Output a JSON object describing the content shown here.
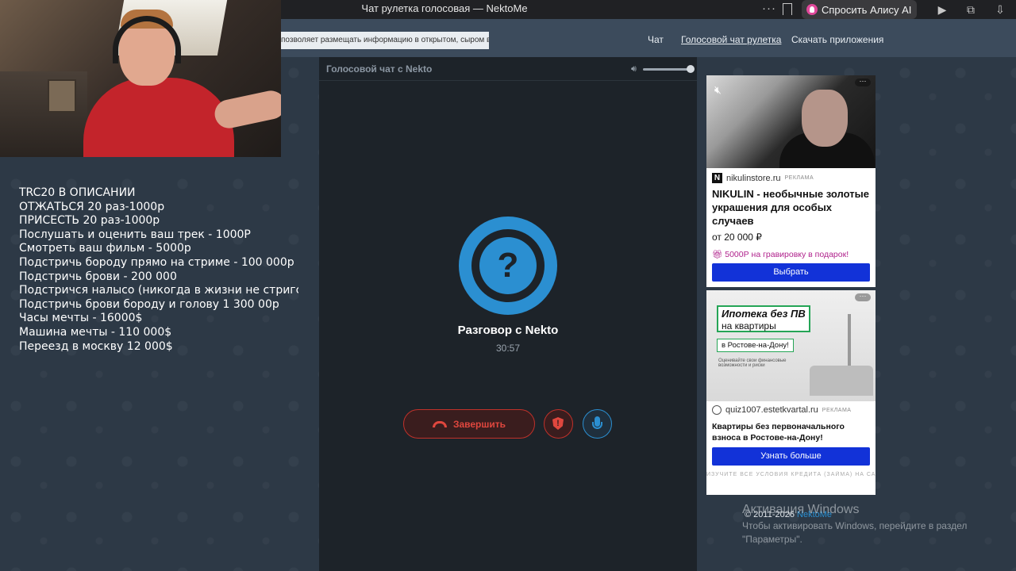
{
  "browser": {
    "title": "Чат рулетка голосовая — NektoMe",
    "alice_label": "Спросить Алису AI"
  },
  "site": {
    "notice": "позволяет размещать информацию в открытом, сыром виде!",
    "nav": [
      "Чат",
      "Голосовой чат рулетка",
      "Скачать приложения"
    ],
    "nav_active": "Голосовой чат рулетка"
  },
  "overlay": {
    "lines": [
      "TRC20 В ОПИСАНИИ",
      "ОТЖАТЬСЯ 20 раз-1000р",
      "ПРИСЕСТЬ 20 раз-1000р",
      "Послушать и оценить ваш трек - 1000Р",
      "Смотреть ваш фильм - 5000р",
      "Подстричь бороду прямо на стриме - 100 000р",
      "Подстричь брови - 200 000",
      "Подстричся налысо (никогда в жизни не стригся н",
      "Подстричь брови бороду и голову 1 300 00р",
      "Часы мечты - 16000$",
      "Машина мечты - 110 000$",
      "Переезд в москву 12 000$"
    ]
  },
  "voice": {
    "panel_title": "Голосовой чат с Nekto",
    "volume_level": 0.92,
    "avatar_symbol": "?",
    "conversation_title": "Разговор с Nekto",
    "timer": "30:57",
    "end_label": "Завершить"
  },
  "ads": {
    "ad1": {
      "source": "nikulinstore.ru",
      "tag": "РЕКЛАМА",
      "title": "NIKULIN - необычные золотые украшения для особых случаев",
      "price": "от 20 000 ₽",
      "promo": "5000Р на гравировку в подарок!",
      "button": "Выбрать"
    },
    "ad2": {
      "headline1": "Ипотека без ПВ",
      "headline2": "на квартиры",
      "city": "в Ростове-на-Дону!",
      "small": "Оценивайте свои финансовые возможности и риски",
      "source": "quiz1007.estetkvartal.ru",
      "tag": "РЕКЛАМА",
      "title": "Квартиры без первоначального взноса в Ростове-на-Дону!",
      "button": "Узнать больше",
      "fine": "ИЗУЧИТЕ ВСЕ УСЛОВИЯ КРЕДИТА (ЗАЙМА) НА САЙТЕ В СООТВЕТСТВУЮЩЕМ РАЗДЕЛЕ"
    }
  },
  "footer": {
    "copyright": "© 2011-2026",
    "brand": "NektoMe"
  },
  "watermark": {
    "line1": "Активация Windows",
    "line2": "Чтобы активировать Windows, перейдите в раздел",
    "line3": "\"Параметры\"."
  },
  "colors": {
    "accent_blue": "#2b8fd1",
    "danger_red": "#e0473e",
    "ad_button": "#1232d8"
  }
}
